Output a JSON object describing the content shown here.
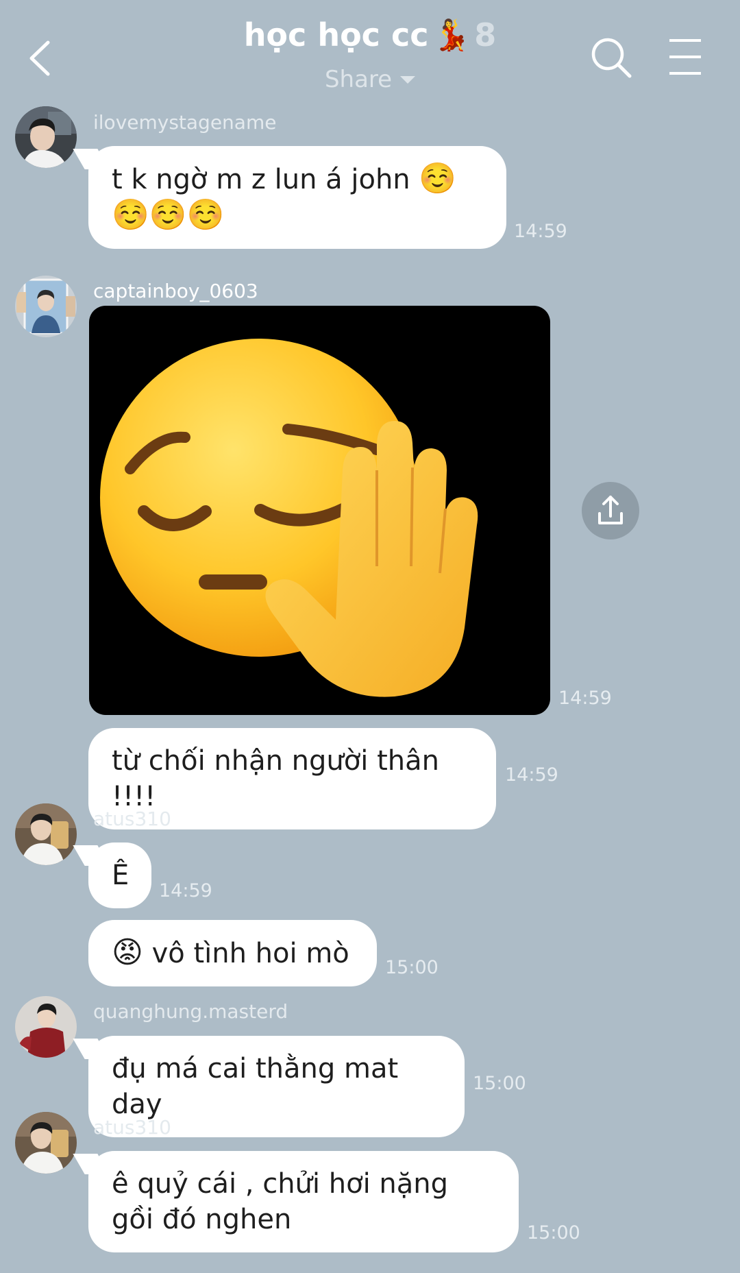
{
  "header": {
    "title": "học học cc",
    "title_emoji": "💃",
    "member_count": "8",
    "share_label": "Share"
  },
  "icons": {
    "back": "chevron-left-icon",
    "search": "search-icon",
    "menu": "hamburger-menu-icon",
    "share": "upload-share-icon"
  },
  "messages": [
    {
      "sender": "ilovemystagename",
      "text": "t k ngờ m z lun á john",
      "emoji": "☺️☺️☺️☺️",
      "time": "14:59"
    },
    {
      "sender": "captainboy_0603",
      "image": "pensive-face-raised-hand-sticker",
      "time": "14:59"
    },
    {
      "text": "từ chối nhận người thân !!!!",
      "time": "14:59"
    },
    {
      "sender": "atus310",
      "text": "Ê",
      "time": "14:59"
    },
    {
      "emoji": "😡",
      "text": "vô tình hoi mò",
      "time": "15:00"
    },
    {
      "sender": "quanghung.masterd",
      "text": "đụ má cai thằng mat day",
      "time": "15:00"
    },
    {
      "sender": "atus310",
      "text": "ê quỷ cái , chửi hơi nặng gồi đó nghen",
      "time": "15:00"
    }
  ],
  "colors": {
    "background": "#adbcc7",
    "bubble": "#ffffff",
    "header_text": "#ffffff",
    "meta_text": "#e6ecf0"
  }
}
